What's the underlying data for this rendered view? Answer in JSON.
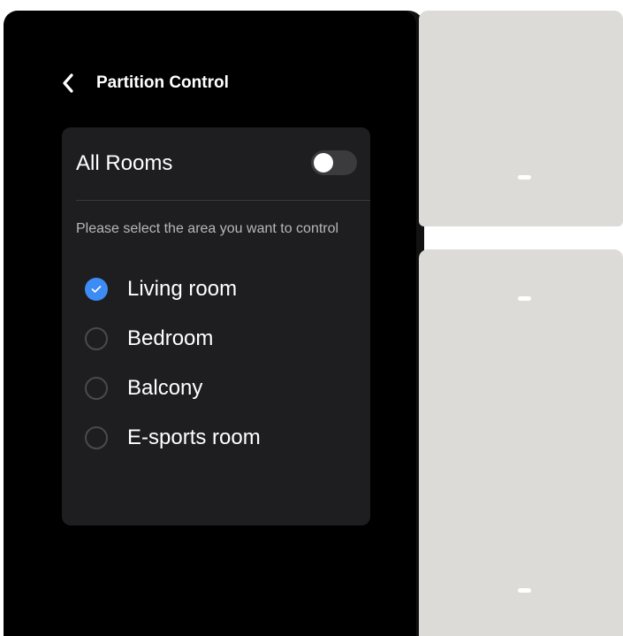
{
  "header": {
    "title": "Partition Control",
    "back_icon": "chevron-left-icon"
  },
  "all_rooms": {
    "label": "All Rooms",
    "toggle_on": false
  },
  "instruction": "Please select the area you want to control",
  "rooms": [
    {
      "label": "Living room",
      "selected": true
    },
    {
      "label": "Bedroom",
      "selected": false
    },
    {
      "label": "Balcony",
      "selected": false
    },
    {
      "label": "E-sports room",
      "selected": false
    }
  ],
  "colors": {
    "screen_background": "#000000",
    "panel_background": "#1e1e20",
    "accent_blue": "#3d8bf5",
    "switch_panel": "#dddbd8"
  }
}
